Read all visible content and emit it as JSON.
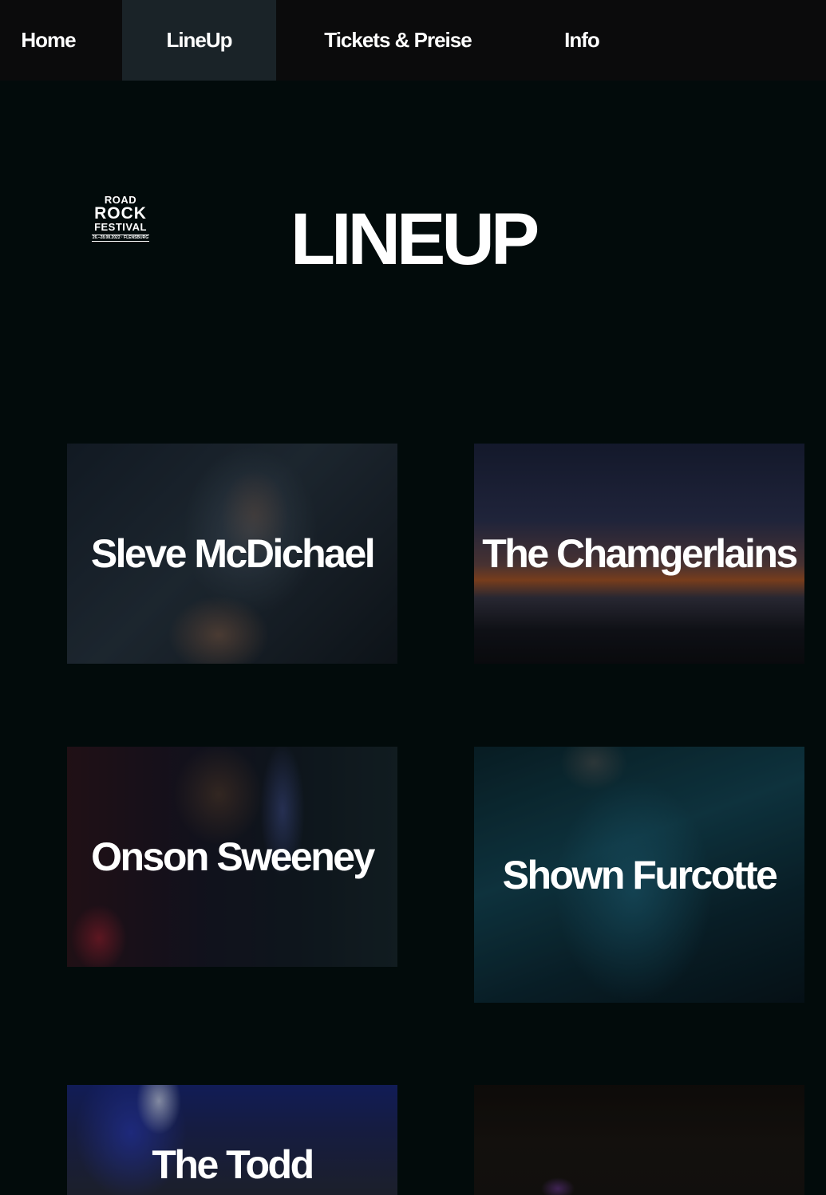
{
  "nav": {
    "items": [
      {
        "label": "Home",
        "active": false
      },
      {
        "label": "LineUp",
        "active": true
      },
      {
        "label": "Tickets & Preise",
        "active": false
      },
      {
        "label": "Info",
        "active": false
      }
    ]
  },
  "logo": {
    "line1": "ROAD",
    "line2": "ROCK",
    "line3": "FESTIVAL",
    "date": "26.–28.08.2022 · FLENSBURG"
  },
  "page": {
    "title": "LINEUP"
  },
  "artists": [
    {
      "name": "Sleve McDichael"
    },
    {
      "name": "The Chamgerlains"
    },
    {
      "name": "Onson Sweeney"
    },
    {
      "name": "Shown Furcotte"
    },
    {
      "name": "The Todd"
    },
    {
      "name": ""
    }
  ],
  "colors": {
    "background": "#020b0b",
    "nav_background": "#0b0b0c",
    "nav_active": "#1a2328",
    "text": "#ffffff"
  }
}
